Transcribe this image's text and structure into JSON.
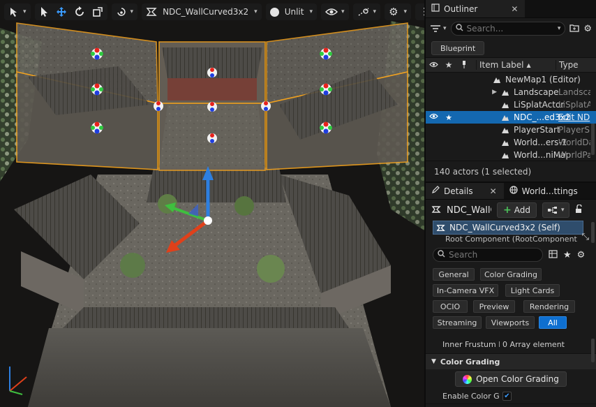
{
  "viewport": {
    "level_name": "NDC_WallCurved3x2",
    "view_mode": "Unlit",
    "icons": [
      "select-mode-icon",
      "select-arrow-icon",
      "translate-icon",
      "rotate-icon",
      "scale-icon",
      "transform-space-icon",
      "camera-icon",
      "eye-icon",
      "snap-icon",
      "settings-icon",
      "more-icon",
      "layout-icon"
    ]
  },
  "outliner": {
    "tab_label": "Outliner",
    "search_placeholder": "Search...",
    "blueprint_label": "Blueprint",
    "columns": {
      "label": "Item Label",
      "type": "Type"
    },
    "rows": [
      {
        "label": "NewMap1 (Editor)",
        "type": "",
        "indent": 0
      },
      {
        "label": "Landscape",
        "type": "Landsca",
        "indent": 1
      },
      {
        "label": "LiSplatActor",
        "type": "LiSplatA",
        "indent": 1
      },
      {
        "label": "NDC_...ed3x2",
        "type": "Edit ND",
        "indent": 1,
        "selected": true
      },
      {
        "label": "PlayerStart",
        "type": "PlayerS",
        "indent": 1
      },
      {
        "label": "World...ers-1",
        "type": "WorldDa",
        "indent": 1
      },
      {
        "label": "World...niMap",
        "type": "WorldPa",
        "indent": 1
      }
    ],
    "status": "140 actors (1 selected)"
  },
  "details": {
    "tab_label": "Details",
    "world_tab_label": "World...ttings",
    "actor_name": "NDC_WallC",
    "add_label": "Add",
    "self_component": "NDC_WallCurved3x2 (Self)",
    "root_component": "Root Component (RootComponent",
    "search_placeholder": "Search",
    "filters": [
      "General",
      "Color Grading",
      "In-Camera VFX",
      "Light Cards",
      "OCIO",
      "Preview",
      "Rendering",
      "Streaming",
      "Viewports",
      "All"
    ],
    "inner_frustum_label": "Inner Frustum P...",
    "inner_frustum_value": "0 Array element",
    "section_color_grading": "Color Grading",
    "open_color_grading": "Open Color Grading",
    "enable_color_grading": "Enable Color Gra..."
  }
}
